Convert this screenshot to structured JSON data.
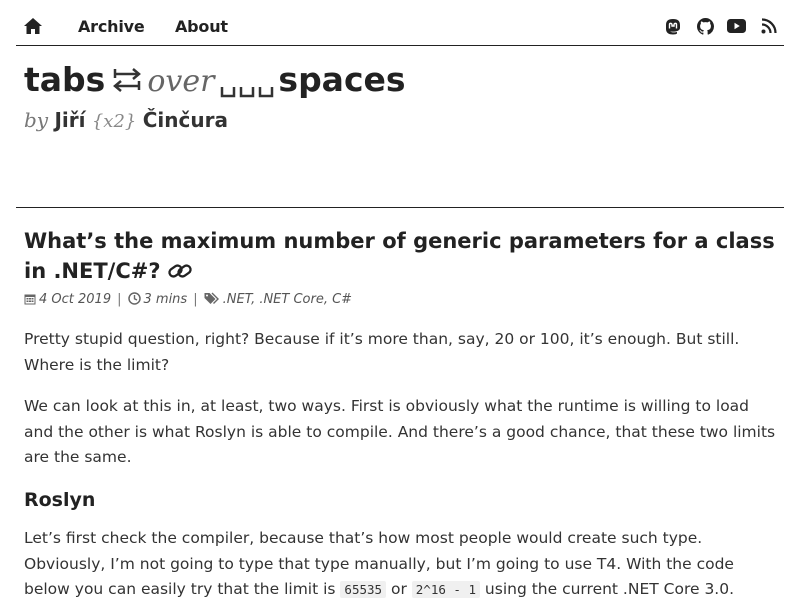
{
  "nav": {
    "home_icon": "home-icon",
    "archive_label": "Archive",
    "about_label": "About",
    "social_icons": [
      "mastodon-icon",
      "github-icon",
      "youtube-icon",
      "rss-icon"
    ]
  },
  "site": {
    "title_word1": "tabs",
    "title_over": "over",
    "title_word2": "spaces",
    "byline_by": "by",
    "byline_first": "Jiří",
    "byline_x2": "{x2}",
    "byline_last": "Činčura"
  },
  "post": {
    "title": "What’s the maximum number of generic parameters for a class in .NET/C#?",
    "date": "4 Oct 2019",
    "read_time": "3 mins",
    "tags": ".NET, .NET Core, C#",
    "p1": "Pretty stupid question, right? Because if it’s more than, say, 20 or 100, it’s enough. But still. Where is the limit?",
    "p2": "We can look at this in, at least, two ways. First is obviously what the runtime is willing to load and the other is what Roslyn is able to compile. And there’s a good chance, that these two limits are the same.",
    "h2": "Roslyn",
    "p3_a": "Let’s first check the compiler, because that’s how most people would create such type. Obviously, I’m not going to type that type manually, but I’m going to use T4. With the code below you can easily try that the limit is ",
    "p3_code1": "65535",
    "p3_or": " or ",
    "p3_code2": "2^16 - 1",
    "p3_b": " using the current .NET Core 3.0."
  },
  "colors": {
    "text": "#222222",
    "muted": "#777777",
    "code_bg": "#f0f0f0"
  }
}
